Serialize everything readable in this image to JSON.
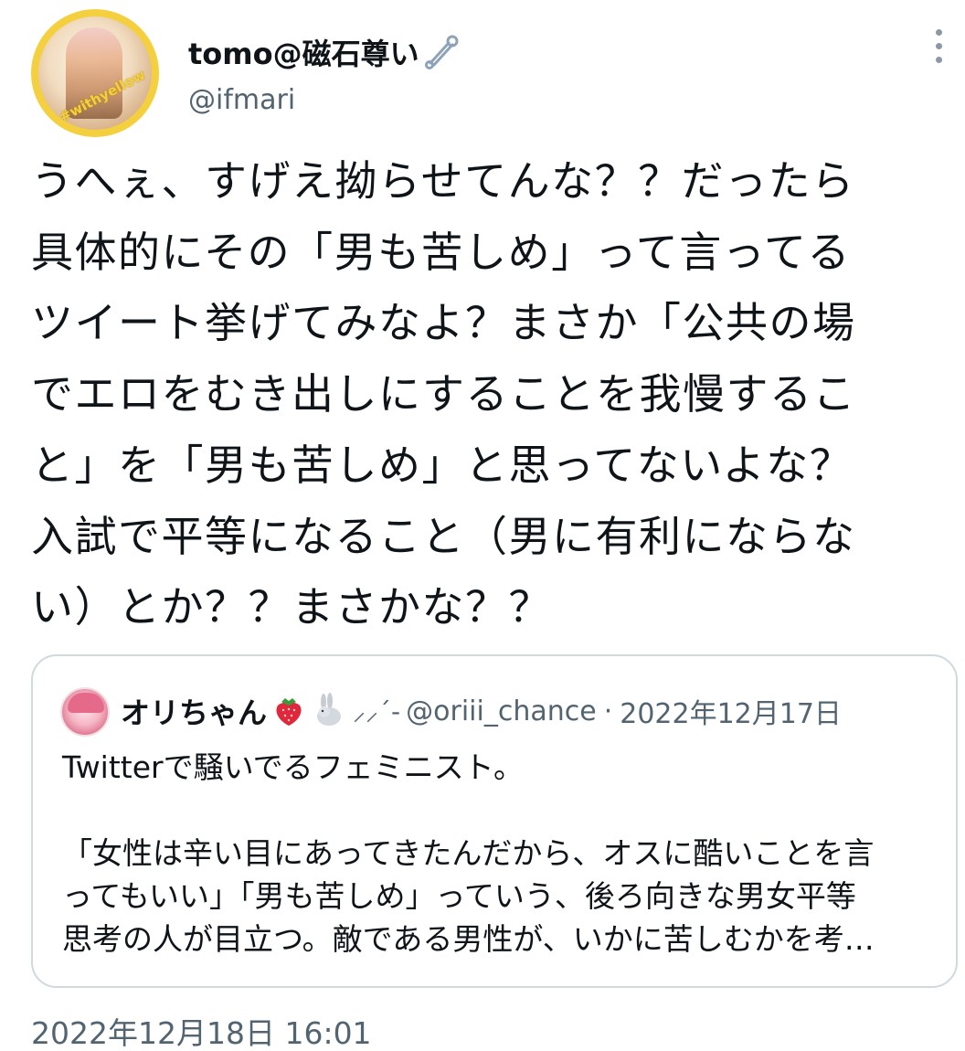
{
  "author": {
    "display_name": "tomo@磁石尊い",
    "name_icon": "safety-pin-icon",
    "handle": "@ifmari",
    "avatar_tag": "#withyellow"
  },
  "tweet": {
    "lines": [
      "うへぇ、すげえ拗らせてんな？？だったら",
      "具体的にその「男も苦しめ」って言ってる",
      "ツイート挙げてみなよ？まさか「公共の場",
      "でエロをむき出しにすることを我慢するこ",
      "と」を「男も苦しめ」と思ってないよな？",
      "入試で平等になること（男に有利にならな",
      "い）とか？？まさかな？？"
    ],
    "timestamp": "2022年12月18日 16:01"
  },
  "quoted_tweet": {
    "display_name": "オリちゃん",
    "emojis": [
      "strawberry-icon",
      "rabbit-icon"
    ],
    "sparkle": "⸝⸝´-",
    "handle": "@oriii_chance",
    "separator": "·",
    "date": "2022年12月17日",
    "lines": [
      "Twitterで騒いでるフェミニスト。",
      "",
      "「女性は辛い目にあってきたんだから、オスに酷いことを言",
      "ってもいい」「男も苦しめ」っていう、後ろ向きな男女平等",
      "思考の人が目立つ。敵である男性が、いかに苦しむかを考…"
    ]
  },
  "colors": {
    "text_primary": "#0f1419",
    "text_secondary": "#536471",
    "border": "#cfd9de",
    "avatar_ring": "#f4d03f"
  }
}
